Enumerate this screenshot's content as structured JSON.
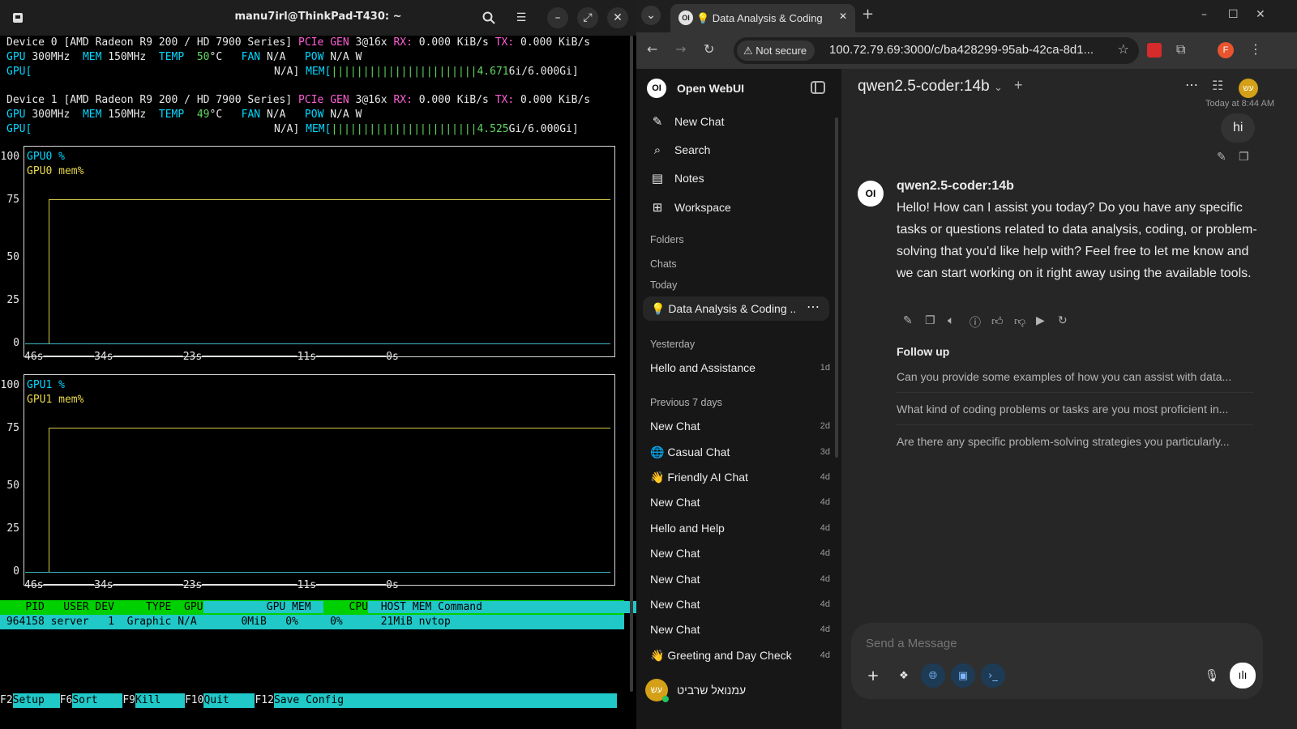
{
  "terminal": {
    "title": "manu7irl@ThinkPad-T430: ~",
    "devices": [
      {
        "line1": {
          "device": "Device 0",
          "name": "[AMD Radeon R9 200 / HD 7900 Series]",
          "pcie_label": "PCIe",
          "gen_label": "GEN",
          "gen_value": "3@16x",
          "rx_label": "RX:",
          "rx": "0.000 KiB/s",
          "tx_label": "TX:",
          "tx": "0.000 KiB/s"
        },
        "line2": {
          "gpu_label": "GPU",
          "gpu_clock": "300MHz",
          "mem_label": "MEM",
          "mem_clock": "150MHz",
          "temp_label": "TEMP",
          "temp": "50",
          "temp_unit": "°C",
          "fan_label": "FAN",
          "fan": "N/A",
          "pow_label": "POW",
          "pow": "N/A W"
        },
        "line3": {
          "gpu_label": "GPU[",
          "gpu_util": "N/A]",
          "mem_label": "MEM[",
          "mem_bars": "|||||||||||||||||||||||4.671",
          "mem_usage": "6i/6.000Gi]"
        }
      },
      {
        "line1": {
          "device": "Device 1",
          "name": "[AMD Radeon R9 200 / HD 7900 Series]",
          "pcie_label": "PCIe",
          "gen_label": "GEN",
          "gen_value": "3@16x",
          "rx_label": "RX:",
          "rx": "0.000 KiB/s",
          "tx_label": "TX:",
          "tx": "0.000 KiB/s"
        },
        "line2": {
          "gpu_label": "GPU",
          "gpu_clock": "300MHz",
          "mem_label": "MEM",
          "mem_clock": "150MHz",
          "temp_label": "TEMP",
          "temp": "49",
          "temp_unit": "°C",
          "fan_label": "FAN",
          "fan": "N/A",
          "pow_label": "POW",
          "pow": "N/A W"
        },
        "line3": {
          "gpu_label": "GPU[",
          "gpu_util": "N/A]",
          "mem_label": "MEM[",
          "mem_bars": "|||||||||||||||||||||||4.525",
          "mem_usage": "Gi/6.000Gi]"
        }
      }
    ],
    "graphs": [
      {
        "legend": [
          "GPU0 %",
          "GPU0 mem%"
        ],
        "y_ticks": [
          "100",
          "75",
          "50",
          "25",
          "0"
        ],
        "x_ticks": [
          "46s",
          "34s",
          "23s",
          "11s",
          "0s"
        ],
        "mem_percent": 76,
        "util_percent": 0
      },
      {
        "legend": [
          "GPU1 %",
          "GPU1 mem%"
        ],
        "y_ticks": [
          "100",
          "75",
          "50",
          "25",
          "0"
        ],
        "x_ticks": [
          "46s",
          "34s",
          "23s",
          "11s",
          "0s"
        ],
        "mem_percent": 76,
        "util_percent": 0
      }
    ],
    "process_header": {
      "pid": "PID",
      "user": "USER",
      "dev": "DEV",
      "type": "TYPE",
      "gpu": "GPU",
      "gpu_mem": "GPU MEM",
      "cpu": "CPU",
      "host_mem": "HOST MEM",
      "command": "Command"
    },
    "process_row": {
      "pid": "964158",
      "user": "server",
      "dev": "1",
      "type": "Graphic",
      "gpu": "N/A",
      "gpu_mem": "0MiB",
      "gpu_mem_pct": "0%",
      "cpu": "0%",
      "host_mem": "21MiB",
      "command": "nvtop"
    },
    "fkeys": [
      {
        "key": "F2",
        "label": "Setup"
      },
      {
        "key": "F6",
        "label": "Sort"
      },
      {
        "key": "F9",
        "label": "Kill"
      },
      {
        "key": "F10",
        "label": "Quit"
      },
      {
        "key": "F12",
        "label": "Save Config"
      }
    ]
  },
  "browser": {
    "tab_title": "💡 Data Analysis & Coding",
    "not_secure": "Not secure",
    "url": "100.72.79.69:3000/c/ba428299-95ab-42ca-8d1...",
    "profile_initial": "F",
    "colors": {
      "profile": "#e8542e",
      "sidebar_bg": "#171717",
      "main_bg": "#262626",
      "accent": "#4a9eff"
    },
    "sidebar": {
      "app_name": "Open WebUI",
      "logo_text": "OI",
      "nav": [
        {
          "label": "New Chat",
          "icon": "edit-icon"
        },
        {
          "label": "Search",
          "icon": "search-icon"
        },
        {
          "label": "Notes",
          "icon": "notes-icon"
        },
        {
          "label": "Workspace",
          "icon": "workspace-icon"
        }
      ],
      "folders_label": "Folders",
      "chats_label": "Chats",
      "today_label": "Today",
      "today_chats": [
        {
          "title": "💡 Data Analysis & Coding ..."
        }
      ],
      "yesterday_label": "Yesterday",
      "yesterday_chats": [
        {
          "title": "Hello and Assistance",
          "age": "1d"
        }
      ],
      "prev7_label": "Previous 7 days",
      "prev7_chats": [
        {
          "title": "New Chat",
          "age": "2d"
        },
        {
          "title": "🌐 Casual Chat",
          "age": "3d"
        },
        {
          "title": "👋 Friendly AI Chat",
          "age": "4d"
        },
        {
          "title": "New Chat",
          "age": "4d"
        },
        {
          "title": "Hello and Help",
          "age": "4d"
        },
        {
          "title": "New Chat",
          "age": "4d"
        },
        {
          "title": "New Chat",
          "age": "4d"
        },
        {
          "title": "New Chat",
          "age": "4d"
        },
        {
          "title": "New Chat",
          "age": "4d"
        },
        {
          "title": "👋 Greeting and Day Check",
          "age": "4d"
        }
      ],
      "user_name": "עמנואל שרביט",
      "user_initials": "עש"
    },
    "main": {
      "model": "qwen2.5-coder:14b",
      "user_initials": "עש",
      "timestamp": "Today at 8:44 AM",
      "user_message": "hi",
      "assistant_name": "qwen2.5-coder:14b",
      "assistant_message": "Hello! How can I assist you today? Do you have any specific tasks or questions related to data analysis, coding, or problem-solving that you'd like help with? Feel free to let me know and we can start working on it right away using the available tools.",
      "follow_up_label": "Follow up",
      "follow_ups": [
        "Can you provide some examples of how you can assist with data...",
        "What kind of coding problems or tasks are you most proficient in...",
        "Are there any specific problem-solving strategies you particularly..."
      ],
      "composer_placeholder": "Send a Message"
    }
  }
}
